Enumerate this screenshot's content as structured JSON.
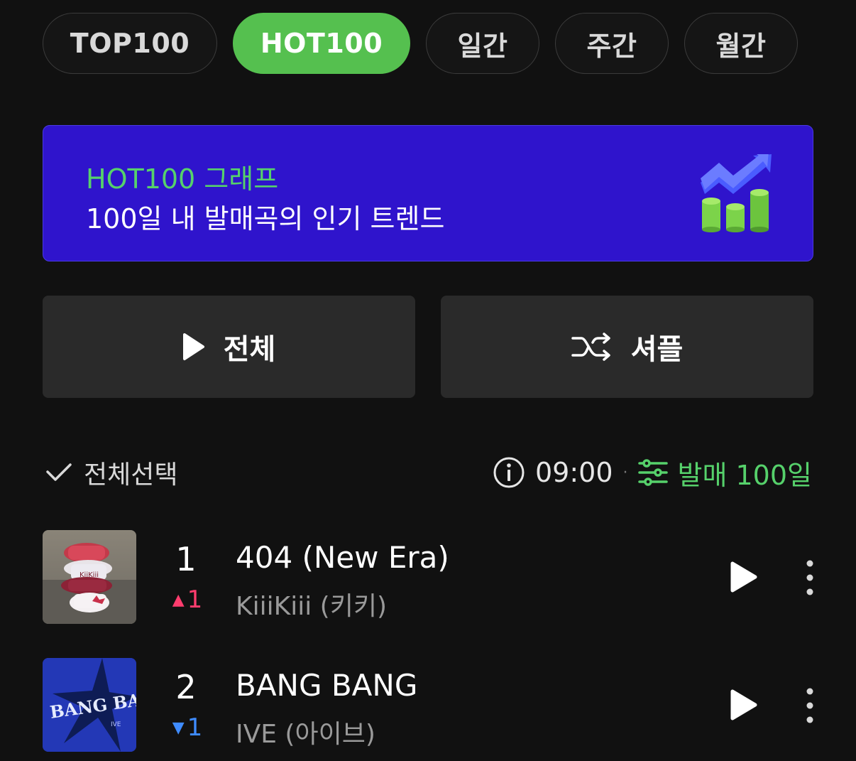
{
  "tabs": [
    {
      "label": "TOP100",
      "active": false
    },
    {
      "label": "HOT100",
      "active": true
    },
    {
      "label": "일간",
      "active": false
    },
    {
      "label": "주간",
      "active": false
    },
    {
      "label": "월간",
      "active": false
    }
  ],
  "banner": {
    "title": "HOT100 그래프",
    "subtitle": "100일 내 발매곡의 인기 트렌드",
    "icon": "trending-bar-chart-icon"
  },
  "actions": {
    "play_all_label": "전체",
    "shuffle_label": "셔플"
  },
  "toolbar": {
    "select_all_label": "전체선택",
    "time": "09:00",
    "separator": "·",
    "filter_label": "발매 100일"
  },
  "colors": {
    "accent_green": "#55c04f",
    "banner_bg": "#2f14cc",
    "rank_up": "#ff3d6e",
    "rank_down": "#3f8cff"
  },
  "chart": [
    {
      "rank": "1",
      "change_direction": "up",
      "change_value": "1",
      "title": "404 (New Era)",
      "artist": "KiiiKiii (키키)"
    },
    {
      "rank": "2",
      "change_direction": "down",
      "change_value": "1",
      "title": "BANG BANG",
      "artist": "IVE (아이브)"
    }
  ]
}
